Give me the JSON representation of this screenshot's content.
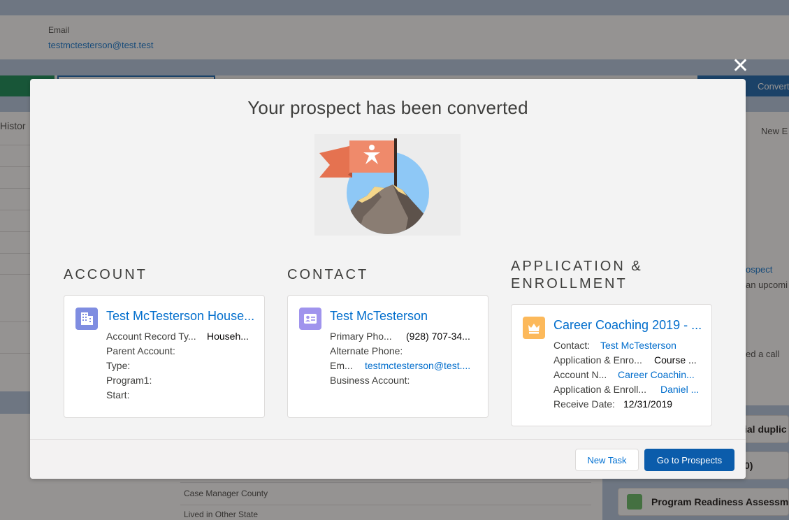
{
  "background": {
    "email_label": "Email",
    "email_value": "testmctesterson@test.test",
    "history_label": "Histor",
    "path_right_label": "Convert",
    "right_panel": {
      "new_label": "New E",
      "prospect_link": "ospect",
      "upcoming_text": "an upcomi",
      "call_text": "ed a call"
    },
    "right_cards": [
      {
        "title": "ial duplic"
      },
      {
        "title": "0)"
      },
      {
        "title": "Program Readiness Assessme"
      }
    ],
    "fields": [
      {
        "label": "Case Manager County"
      },
      {
        "label": "Lived in Other State"
      }
    ]
  },
  "modal": {
    "title": "Your prospect has been converted",
    "close_label": "×",
    "columns": {
      "account": {
        "heading": "ACCOUNT",
        "name": "Test McTesterson House...",
        "fields": [
          {
            "label": "Account Record Ty...",
            "value": "Househ..."
          },
          {
            "label": "Parent Account:",
            "value": ""
          },
          {
            "label": "Type:",
            "value": ""
          },
          {
            "label": "Program1:",
            "value": ""
          },
          {
            "label": "Start:",
            "value": ""
          }
        ]
      },
      "contact": {
        "heading": "CONTACT",
        "name": "Test McTesterson",
        "fields": [
          {
            "label": "Primary Pho...",
            "value": "(928) 707-34..."
          },
          {
            "label": "Alternate Phone:",
            "value": ""
          },
          {
            "label": "Em...",
            "value": "testmctesterson@test...."
          },
          {
            "label": "Business Account:",
            "value": ""
          }
        ]
      },
      "application": {
        "heading_line1": "APPLICATION &",
        "heading_line2": "ENROLLMENT",
        "name": "Career Coaching 2019 - ...",
        "fields": [
          {
            "label": "Contact:",
            "value": "Test McTesterson"
          },
          {
            "label": "Application & Enro...",
            "value": "Course ..."
          },
          {
            "label": "Account N...",
            "value": "Career Coachin..."
          },
          {
            "label": "Application & Enroll...",
            "value": "Daniel ..."
          },
          {
            "label": "Receive Date:",
            "value": "12/31/2019"
          }
        ]
      }
    },
    "footer": {
      "new_task_label": "New Task",
      "go_label": "Go to Prospects"
    }
  },
  "colors": {
    "link": "#006dcc",
    "brand_button": "#0b5cab",
    "account_icon": "#7f8de1",
    "contact_icon": "#a094ed",
    "application_icon": "#fcb95b",
    "flag": "#e8785b"
  },
  "icons": {
    "account": "building-icon",
    "contact": "contact-card-icon",
    "application": "crown-icon",
    "close": "close-icon"
  }
}
